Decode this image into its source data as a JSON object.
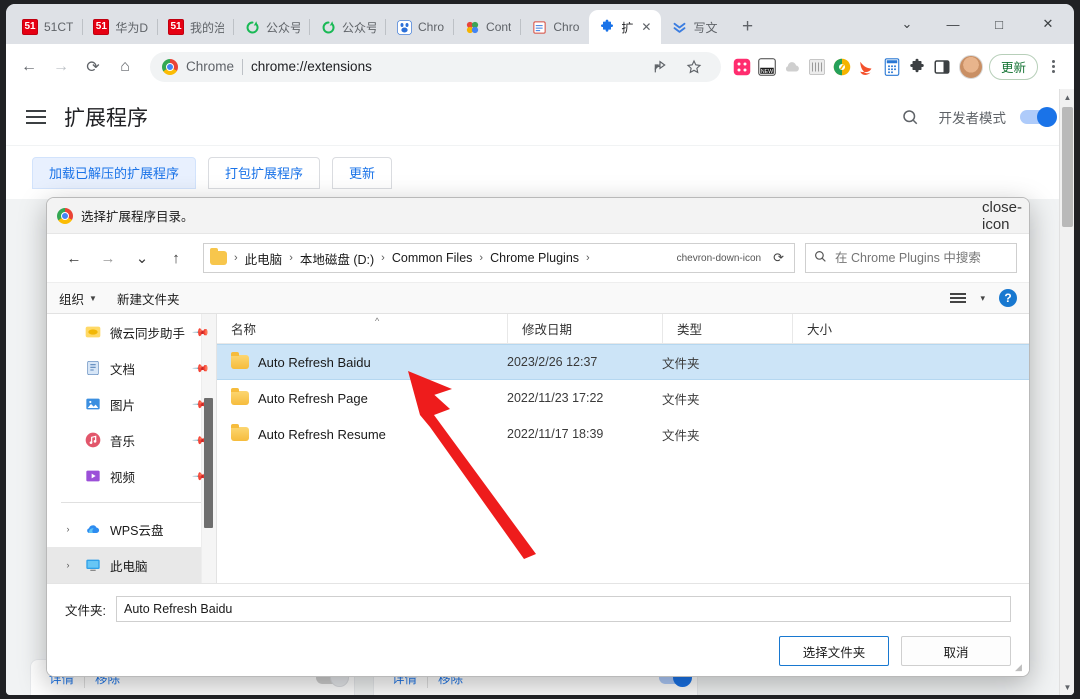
{
  "browser": {
    "tabs": [
      {
        "title": "51CT",
        "icon": "51-icon",
        "active": false
      },
      {
        "title": "华为D",
        "icon": "51-icon",
        "active": false
      },
      {
        "title": "我的治",
        "icon": "51-icon",
        "active": false
      },
      {
        "title": "公众号",
        "icon": "refresh-green-icon",
        "active": false
      },
      {
        "title": "公众号",
        "icon": "refresh-green-icon",
        "active": false
      },
      {
        "title": "Chro",
        "icon": "baidu-icon",
        "active": false
      },
      {
        "title": "Cont",
        "icon": "pinwheel-icon",
        "active": false
      },
      {
        "title": "Chro",
        "icon": "doc-red-icon",
        "active": false
      },
      {
        "title": "扩",
        "icon": "puzzle-icon",
        "active": true
      },
      {
        "title": "写文",
        "icon": "chevrons-down-icon",
        "active": false
      }
    ],
    "new_tab_label": "+",
    "window_controls": {
      "tab_search": "⌄",
      "minimize": "—",
      "maximize": "□",
      "close": "✕"
    },
    "toolbar": {
      "back": "←",
      "forward": "→",
      "reload": "⟳",
      "home": "⌂",
      "omnibox": {
        "site_label": "Chrome",
        "url": "chrome://extensions",
        "share_icon": "share-icon",
        "bookmark_icon": "star-icon"
      },
      "extensions": [
        "dice-pink-icon",
        "new-badge-icon",
        "cloud-grey-icon",
        "grid-grey-icon",
        "compass-icon",
        "swift-bird-icon",
        "calculator-icon",
        "puzzle-icon",
        "side-panel-icon"
      ],
      "avatar": "user-avatar",
      "update_button": "更新",
      "menu": "kebab-menu-icon"
    }
  },
  "extensions_page": {
    "menu_icon": "hamburger-icon",
    "title": "扩展程序",
    "search_icon": "search-icon",
    "developer_mode_label": "开发者模式",
    "developer_mode_on": true,
    "dev_buttons": [
      "加载已解压的扩展程序",
      "打包扩展程序",
      "更新"
    ],
    "cards": [
      {
        "details": "详情",
        "remove": "移除",
        "enabled": false
      },
      {
        "details": "详情",
        "remove": "移除",
        "enabled": true
      }
    ]
  },
  "file_dialog": {
    "title": "选择扩展程序目录。",
    "title_icon": "chrome-icon",
    "close_icon": "close-icon",
    "nav": {
      "back": "←",
      "forward": "→",
      "recent": "⌄",
      "up": "↑",
      "breadcrumb_icon": "folder-icon",
      "breadcrumbs": [
        "此电脑",
        "本地磁盘 (D:)",
        "Common Files",
        "Chrome Plugins"
      ],
      "dropdown_icon": "chevron-down-icon",
      "refresh_icon": "refresh-icon",
      "search_placeholder": "在 Chrome Plugins 中搜索",
      "search_value": "",
      "search_icon": "search-icon"
    },
    "command_bar": {
      "organize": "组织",
      "new_folder": "新建文件夹",
      "view_icon": "list-view-icon",
      "view_caret": "▾",
      "help": "?"
    },
    "sidebar": [
      {
        "label": "微云同步助手",
        "icon": "weiyun-icon",
        "pinned": true,
        "expander": false,
        "selected": false
      },
      {
        "label": "文档",
        "icon": "documents-icon",
        "pinned": true,
        "expander": false,
        "selected": false
      },
      {
        "label": "图片",
        "icon": "pictures-icon",
        "pinned": true,
        "expander": false,
        "selected": false
      },
      {
        "label": "音乐",
        "icon": "music-icon",
        "pinned": true,
        "expander": false,
        "selected": false
      },
      {
        "label": "视频",
        "icon": "videos-icon",
        "pinned": true,
        "expander": false,
        "selected": false
      },
      {
        "label": "WPS云盘",
        "icon": "wps-cloud-icon",
        "pinned": false,
        "expander": true,
        "selected": false
      },
      {
        "label": "此电脑",
        "icon": "this-pc-icon",
        "pinned": false,
        "expander": true,
        "selected": true
      }
    ],
    "columns": [
      "名称",
      "修改日期",
      "类型",
      "大小"
    ],
    "sort_indicator": "^",
    "rows": [
      {
        "name": "Auto Refresh Baidu",
        "date": "2023/2/26 12:37",
        "type": "文件夹",
        "size": "",
        "selected": true
      },
      {
        "name": "Auto Refresh Page",
        "date": "2022/11/23 17:22",
        "type": "文件夹",
        "size": "",
        "selected": false
      },
      {
        "name": "Auto Refresh Resume",
        "date": "2022/11/17 18:39",
        "type": "文件夹",
        "size": "",
        "selected": false
      }
    ],
    "footer": {
      "folder_label": "文件夹:",
      "folder_value": "Auto Refresh Baidu",
      "select_button": "选择文件夹",
      "cancel_button": "取消"
    }
  },
  "annotation": {
    "arrow_color": "#ee1c1c"
  }
}
